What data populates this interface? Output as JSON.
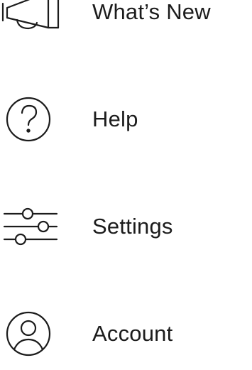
{
  "menu": {
    "items": [
      {
        "label": "What’s New",
        "icon": "megaphone-icon"
      },
      {
        "label": "Help",
        "icon": "question-circle-icon"
      },
      {
        "label": "Settings",
        "icon": "sliders-icon"
      },
      {
        "label": "Account",
        "icon": "user-circle-icon"
      }
    ]
  },
  "colors": {
    "text": "#1c1c1c",
    "icon_stroke": "#1c1c1c",
    "background": "#ffffff"
  }
}
